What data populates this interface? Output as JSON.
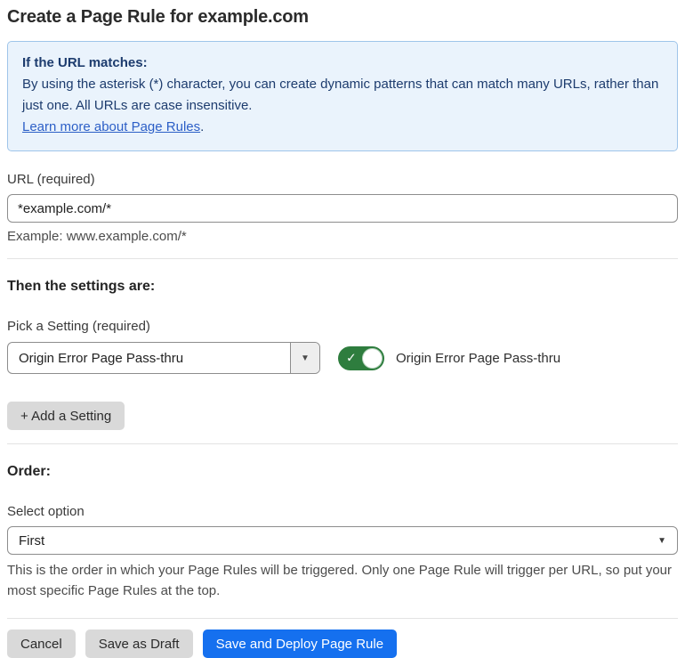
{
  "page": {
    "title": "Create a Page Rule for example.com"
  },
  "info_box": {
    "heading": "If the URL matches:",
    "body": "By using the asterisk (*) character, you can create dynamic patterns that can match many URLs, rather than just one. All URLs are case insensitive.",
    "link_text": "Learn more about Page Rules",
    "link_suffix": "."
  },
  "url_section": {
    "label": "URL (required)",
    "value": "*example.com/*",
    "helper": "Example: www.example.com/*"
  },
  "settings_section": {
    "heading": "Then the settings are:",
    "pick_label": "Pick a Setting (required)",
    "selected_setting": "Origin Error Page Pass-thru",
    "dropdown_arrow": "▼",
    "toggle_state": "on",
    "toggle_check": "✓",
    "toggle_label": "Origin Error Page Pass-thru",
    "add_button_label": "+ Add a Setting"
  },
  "order_section": {
    "heading": "Order:",
    "select_label": "Select option",
    "selected_option": "First",
    "dropdown_arrow": "▼",
    "description": "This is the order in which your Page Rules will be triggered. Only one Page Rule will trigger per URL, so put your most specific Page Rules at the top."
  },
  "footer": {
    "cancel_label": "Cancel",
    "save_draft_label": "Save as Draft",
    "save_deploy_label": "Save and Deploy Page Rule"
  },
  "colors": {
    "accent_blue": "#1570ef",
    "toggle_green": "#2e7d3e",
    "info_background": "#eaf3fc",
    "info_border": "#9fc5ea",
    "info_text": "#1d3c6e",
    "link_blue": "#2c5fc7",
    "gray_button": "#d9d9d9"
  }
}
